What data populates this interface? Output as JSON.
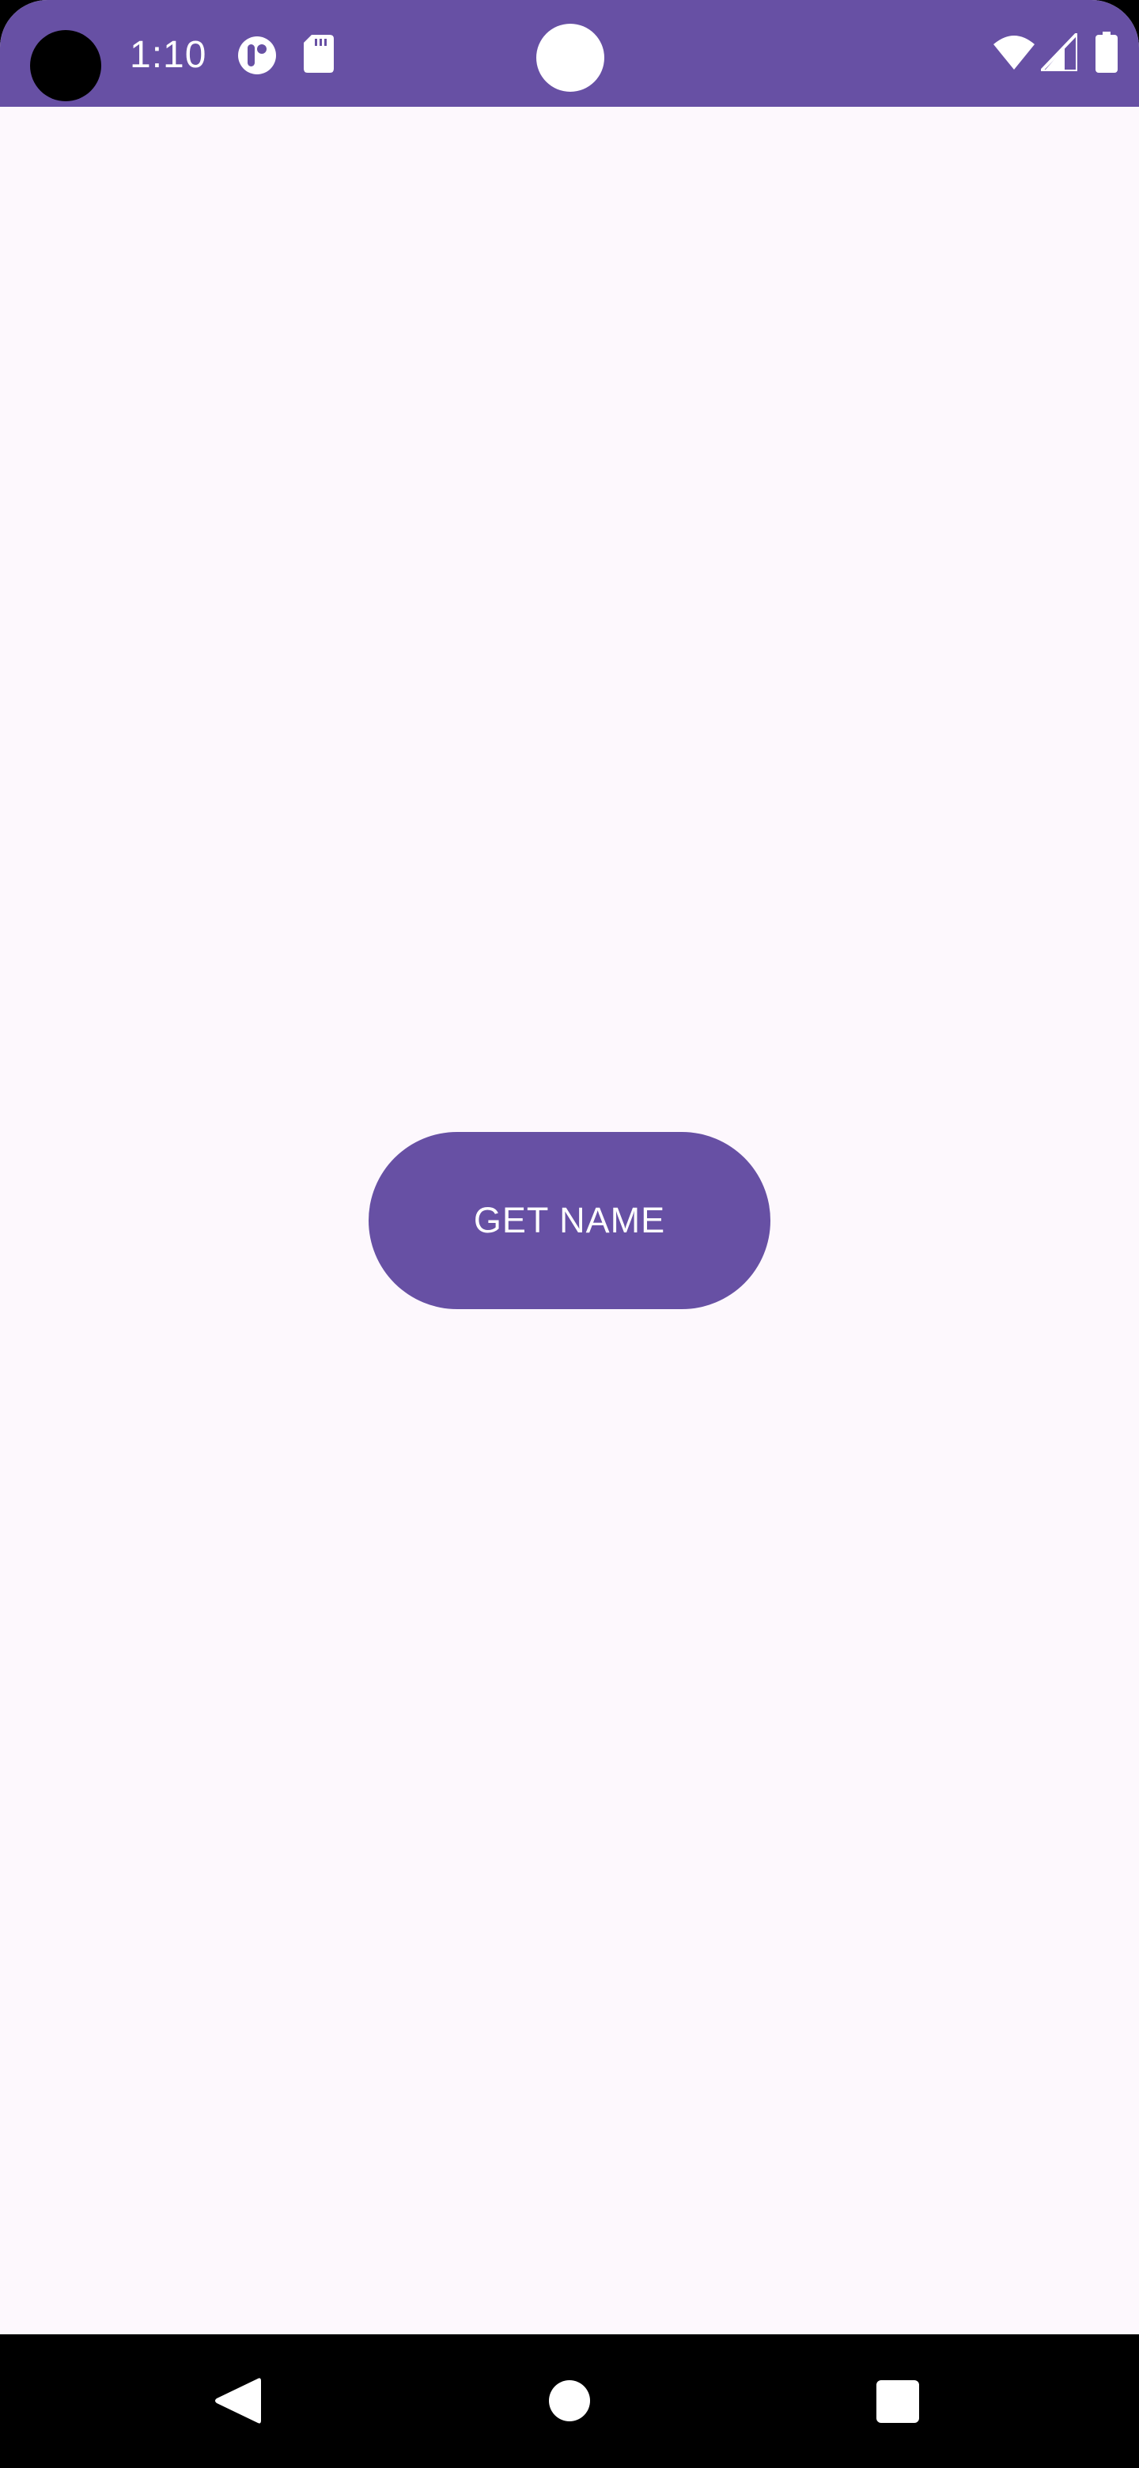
{
  "status_bar": {
    "time": "1:10",
    "background_color": "#6750A4",
    "icons": [
      "notification-app-icon",
      "sd-card-icon",
      "wifi-icon",
      "cell-signal-icon",
      "battery-icon"
    ]
  },
  "main": {
    "get_name_button": {
      "label": "GET NAME",
      "color": "#6750A4",
      "text_color": "#FFFFFF"
    },
    "background_color": "#FDF8FD"
  },
  "nav_bar": {
    "buttons": [
      "back-icon",
      "home-icon",
      "recents-icon"
    ]
  }
}
